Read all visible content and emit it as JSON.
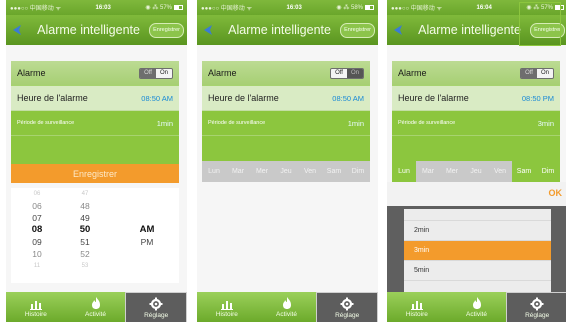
{
  "screens": [
    {
      "status": {
        "carrier": "●●●○○ 中国移动 ᯤ",
        "time": "16:03",
        "battery": "◉ ⁂ 57%"
      },
      "nav": {
        "title": "Alarme intelligente",
        "save": "Enregistrer"
      },
      "rows": {
        "alarme_label": "Alarme",
        "toggle_off": "Off",
        "toggle_on": "On",
        "heure_label": "Heure de l'alarme",
        "heure_value": "08:50 AM",
        "periode_label": "Période de surveillance",
        "periode_value": "1min"
      },
      "save_bar": "Enregistrer",
      "picker": {
        "hours": [
          "06",
          "06",
          "07",
          "08",
          "09",
          "10",
          "11"
        ],
        "minutes": [
          "47",
          "48",
          "49",
          "50",
          "51",
          "52",
          "53"
        ],
        "ampm": [
          "",
          "",
          "",
          "AM",
          "PM",
          "",
          ""
        ]
      }
    },
    {
      "status": {
        "carrier": "●●●○○ 中国移动 ᯤ",
        "time": "16:03",
        "battery": "◉ ⁂ 58%"
      },
      "nav": {
        "title": "Alarme intelligente",
        "save": "Enregistrer"
      },
      "rows": {
        "alarme_label": "Alarme",
        "toggle_off": "Off",
        "toggle_on": "On",
        "heure_label": "Heure de l'alarme",
        "heure_value": "08:50 AM",
        "periode_label": "Période de surveillance",
        "periode_value": "1min"
      },
      "days": [
        "Lun",
        "Mar",
        "Mer",
        "Jeu",
        "Ven",
        "Sam",
        "Dim"
      ]
    },
    {
      "status": {
        "carrier": "●●●○○ 中国移动 ᯤ",
        "time": "16:04",
        "battery": "◉ ⁂ 57%"
      },
      "nav": {
        "title": "Alarme intelligente",
        "save": "Enregistrer"
      },
      "rows": {
        "alarme_label": "Alarme",
        "toggle_off": "Off",
        "toggle_on": "On",
        "heure_label": "Heure de l'alarme",
        "heure_value": "08:50 PM",
        "periode_label": "Période de surveillance",
        "periode_value": "3min"
      },
      "days": [
        "Lun",
        "Mar",
        "Mer",
        "Jeu",
        "Ven",
        "Sam",
        "Dim"
      ],
      "ok": "OK",
      "durations": [
        "2min",
        "3min",
        "5min"
      ]
    }
  ],
  "tabs": [
    "Histoire",
    "Activité",
    "Réglage"
  ],
  "colors": {
    "green": "#8cc63e",
    "orange": "#f39b2c",
    "blue": "#1a8ad6"
  },
  "icons": {
    "back": "back-arrow-icon",
    "histoire": "bar-chart-icon",
    "activite": "flame-icon",
    "reglage": "gear-icon"
  }
}
